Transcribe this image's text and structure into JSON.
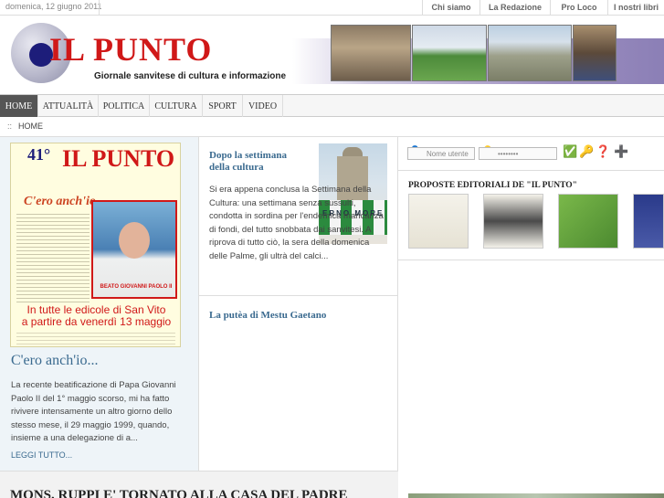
{
  "topbar": {
    "date": "domenica, 12 giugno 2011",
    "links": [
      "Chi siamo",
      "La Redazione",
      "Pro Loco",
      "I nostri libri"
    ]
  },
  "header": {
    "title": "IL PUNTO",
    "subtitle": "Giornale sanvitese di cultura e informazione"
  },
  "nav": {
    "items": [
      "HOME",
      "ATTUALITÀ",
      "POLITICA",
      "CULTURA",
      "SPORT",
      "VIDEO"
    ],
    "active": "HOME"
  },
  "breadcrumb": {
    "separator": "::",
    "current": "HOME"
  },
  "left": {
    "cover": {
      "number": "41°",
      "title": "IL PUNTO",
      "heading": "C'ero anch'io...",
      "caption": "BEATO GIOVANNI PAOLO II",
      "banner_line1": "In tutte le edicole di San Vito",
      "banner_line2": "a partire da venerdì 13 maggio"
    },
    "title": "C'ero anch'io...",
    "body": "La recente beatificazione di Papa Giovanni Paolo II del 1° maggio scorso, mi ha fatto rivivere intensamente un altro giorno dello stesso mese, il 29 maggio 1999, quando, insieme a una delegazione di a...",
    "read_more": "LEGGI TUTTO..."
  },
  "middle": {
    "article1": {
      "title": "Dopo la settimana della cultura",
      "body": "Si era appena conclusa la Settimana della Cultura: una settimana senza sussulti, condotta in sordina per l'endemica mancanza di fondi, del tutto snobbata dai sanvitesi. A riprova di tutto ciò, la sera della domenica delle Palme, gli ultrà del calci...",
      "image_text": "ERNO MORE"
    },
    "article2": {
      "title": "La putèa di Mestu Gaetano"
    }
  },
  "right": {
    "login": {
      "username_placeholder": "Nome utente",
      "password_value": "••••••••"
    },
    "proposte_title": "PROPOSTE EDITORIALI DE \"IL PUNTO\""
  },
  "bottom": {
    "headline": "MONS. RUPPI E' TORNATO ALLA CASA DEL PADRE"
  },
  "colors": {
    "brand_red": "#d01818",
    "brand_blue": "#1d1d7a",
    "link_blue": "#3a6a8f",
    "nav_active": "#555555"
  }
}
